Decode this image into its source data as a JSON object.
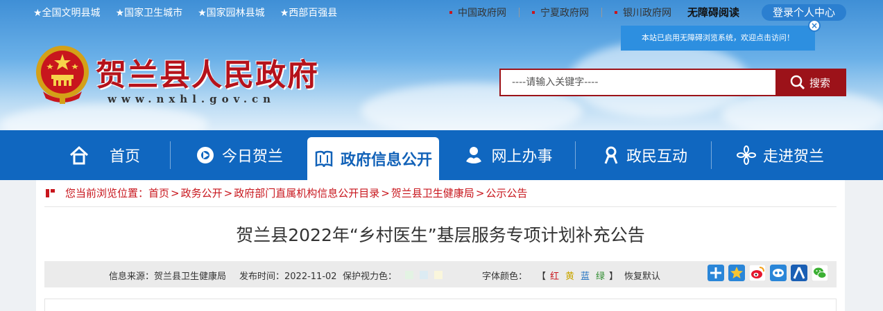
{
  "header": {
    "honors": [
      "★全国文明县城",
      "★国家卫生城市",
      "★国家园林县城",
      "★西部百强县"
    ],
    "top_links": [
      "中国政府网",
      "宁夏政府网",
      "银川政府网"
    ],
    "barrier_free": "无障碍阅读",
    "login": "登录个人中心",
    "tooltip": "本站已启用无障碍浏览系统，欢迎点击访问！",
    "tooltip_close": "×",
    "site_title": "贺兰县人民政府",
    "site_url": "www.nxhl.gov.cn",
    "search": {
      "placeholder": "----请输入关键字----",
      "button": "搜索"
    }
  },
  "nav": {
    "items": [
      {
        "label": "首页",
        "icon": "home-icon"
      },
      {
        "label": "今日贺兰",
        "icon": "compass-icon"
      },
      {
        "label": "政府信息公开",
        "icon": "book-icon"
      },
      {
        "label": "网上办事",
        "icon": "handshake-icon"
      },
      {
        "label": "政民互动",
        "icon": "person-icon"
      },
      {
        "label": "走进贺兰",
        "icon": "flower-icon"
      }
    ],
    "active_index": 2
  },
  "breadcrumb": {
    "prefix": "您当前浏览位置：",
    "items": [
      "首页",
      "政务公开",
      "政府部门直属机构信息公开目录",
      "贺兰县卫生健康局",
      "公示公告"
    ],
    "separator": ">"
  },
  "article": {
    "title": "贺兰县2022年“乡村医生”基层服务专项计划补充公告",
    "source": "信息来源：贺兰县卫生健康局",
    "date": "发布时间：2022-11-02",
    "eye_color_label": "保护视力色：",
    "eye_colors": [
      "#e3f3e3",
      "#dcebf3",
      "#faf6dc"
    ],
    "font_color_label": "字体颜色：",
    "bracket_open": "【",
    "font_colors": [
      {
        "label": "红",
        "color": "#c8161d"
      },
      {
        "label": "黄",
        "color": "#c9a600"
      },
      {
        "label": "蓝",
        "color": "#1d6fc0"
      },
      {
        "label": "绿",
        "color": "#2e8b2e"
      }
    ],
    "bracket_close": "】",
    "reset": "恢复默认",
    "share_icons": [
      "plus-share-icon",
      "star-share-icon",
      "weibo-share-icon",
      "tencent-share-icon",
      "renren-share-icon",
      "wechat-share-icon"
    ]
  },
  "colors": {
    "nav_bg": "#1067c0",
    "brand_red": "#b5121b",
    "search_red": "#9c1219"
  }
}
